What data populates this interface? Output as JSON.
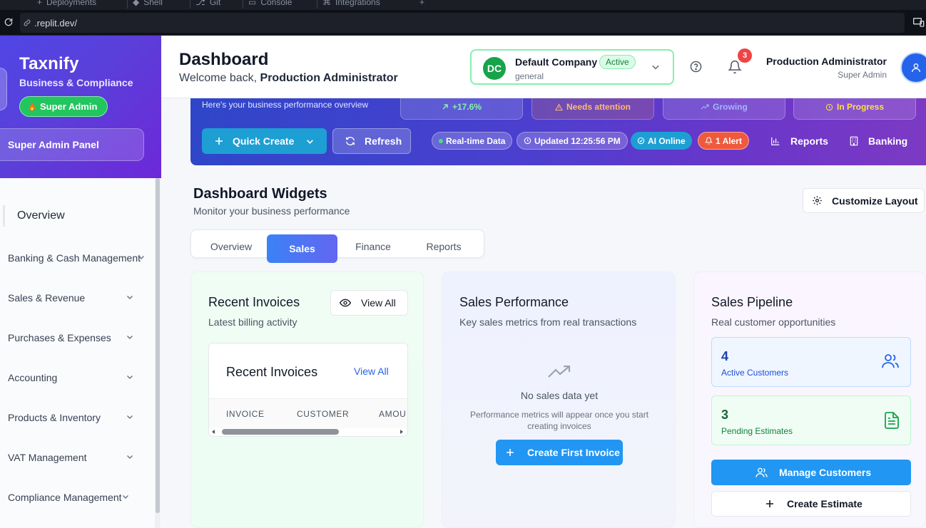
{
  "browser": {
    "tabs": [
      "Deployments",
      "Shell",
      "Git",
      "Console",
      "Integrations"
    ],
    "url": ".replit.dev/"
  },
  "sidebar": {
    "brand": "Taxnify",
    "brand_sub": "Business & Compliance",
    "badge": "Super Admin",
    "panel": "Super Admin Panel",
    "overview": "Overview",
    "items": [
      {
        "label": "Banking & Cash Management"
      },
      {
        "label": "Sales & Revenue"
      },
      {
        "label": "Purchases & Expenses"
      },
      {
        "label": "Accounting"
      },
      {
        "label": "Products & Inventory"
      },
      {
        "label": "VAT Management"
      },
      {
        "label": "Compliance Management"
      }
    ]
  },
  "header": {
    "title": "Dashboard",
    "welcome_prefix": "Welcome back, ",
    "welcome_name": "Production Administrator",
    "company": {
      "initials": "DC",
      "name": "Default Company",
      "status": "Active",
      "sub": "general"
    },
    "notifications_count": "3",
    "user": {
      "name": "Production Administrator",
      "role": "Super Admin"
    }
  },
  "hero": {
    "subtitle": "Here's your business performance overview",
    "stats": [
      {
        "label": "+17.6%",
        "color": "#86efac"
      },
      {
        "label": "Needs attention",
        "color": "#fdba74"
      },
      {
        "label": "Growing",
        "color": "#a5b4fc"
      },
      {
        "label": "In Progress",
        "color": "#fde047"
      }
    ],
    "quick_create": "Quick Create",
    "refresh": "Refresh",
    "chips": {
      "realtime": "Real-time Data",
      "updated": "Updated 12:25:56 PM",
      "ai": "AI Online",
      "alert": "1 Alert"
    },
    "links": {
      "reports": "Reports",
      "banking": "Banking"
    }
  },
  "widgets": {
    "title": "Dashboard Widgets",
    "subtitle": "Monitor your business performance",
    "customize": "Customize Layout",
    "tabs": [
      "Overview",
      "Sales",
      "Finance",
      "Reports"
    ],
    "active_tab": "Sales"
  },
  "recent_invoices": {
    "title": "Recent Invoices",
    "subtitle": "Latest billing activity",
    "view_all": "View All",
    "inner_title": "Recent Invoices",
    "inner_view_all": "View All",
    "columns": [
      "INVOICE",
      "CUSTOMER",
      "AMOU"
    ]
  },
  "sales_performance": {
    "title": "Sales Performance",
    "subtitle": "Key sales metrics from real transactions",
    "empty_title": "No sales data yet",
    "empty_sub": "Performance metrics will appear once you start creating invoices",
    "cta": "Create First Invoice"
  },
  "sales_pipeline": {
    "title": "Sales Pipeline",
    "subtitle": "Real customer opportunities",
    "active_customers": {
      "value": "4",
      "label": "Active Customers"
    },
    "pending_estimates": {
      "value": "3",
      "label": "Pending Estimates"
    },
    "manage": "Manage Customers",
    "create_estimate": "Create Estimate"
  }
}
